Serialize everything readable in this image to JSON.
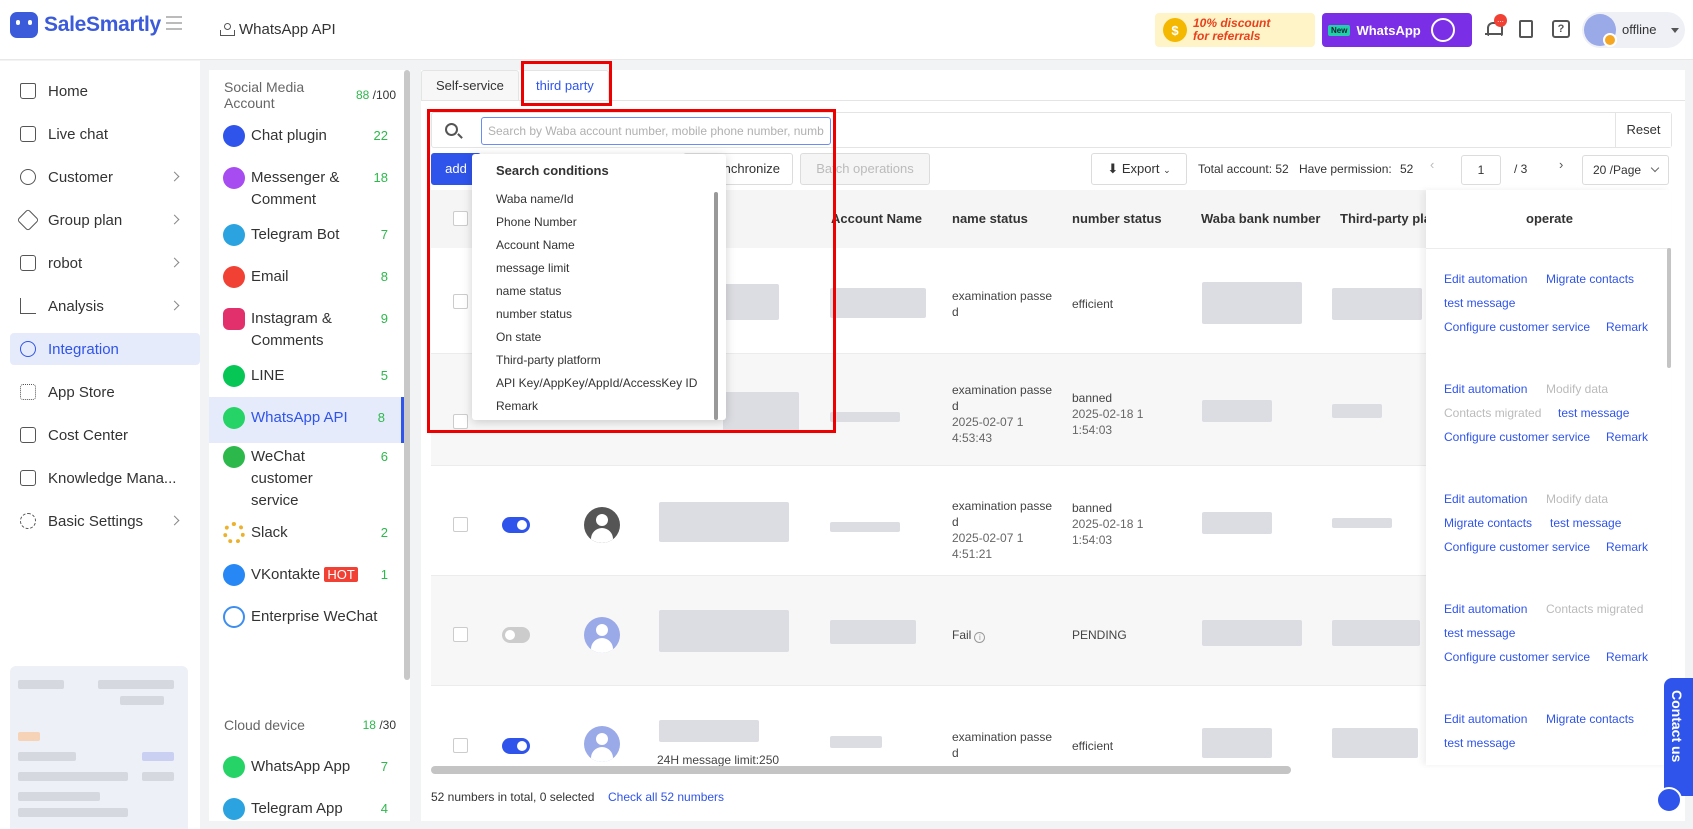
{
  "app": {
    "name": "SaleSmartly",
    "page": "WhatsApp API"
  },
  "promos": {
    "discount": "10% discount for referrals",
    "discount_line1": "10% discount",
    "discount_line2": "for referrals",
    "new_badge": "New",
    "whatsapp": "WhatsApp"
  },
  "header": {
    "notification_count": "...",
    "user_status": "offline"
  },
  "nav": [
    {
      "label": "Home",
      "icon": "home-icon"
    },
    {
      "label": "Live chat",
      "icon": "chat-icon"
    },
    {
      "label": "Customer",
      "icon": "customer-icon"
    },
    {
      "label": "Group plan",
      "icon": "send-icon"
    },
    {
      "label": "robot",
      "icon": "robot-icon"
    },
    {
      "label": "Analysis",
      "icon": "chart-icon"
    },
    {
      "label": "Integration",
      "icon": "integration-icon",
      "active": true
    },
    {
      "label": "App Store",
      "icon": "grid-icon"
    },
    {
      "label": "Cost Center",
      "icon": "wallet-icon"
    },
    {
      "label": "Knowledge Mana...",
      "icon": "book-icon"
    },
    {
      "label": "Basic Settings",
      "icon": "gear-icon"
    }
  ],
  "social": {
    "heading_line1": "Social Media",
    "heading_line2": "Account",
    "used": "88",
    "total": "/100",
    "channels": [
      {
        "label": "Chat plugin",
        "count": "22",
        "color": "#2f54eb"
      },
      {
        "label": "Messenger & Comment",
        "count": "18",
        "color": "#a64cf0"
      },
      {
        "label": "Telegram Bot",
        "count": "7",
        "color": "#2aa3e0"
      },
      {
        "label": "Email",
        "count": "8",
        "color": "#f04134"
      },
      {
        "label": "Instagram & Comments",
        "count": "9",
        "color": "#e1306c"
      },
      {
        "label": "LINE",
        "count": "5",
        "color": "#06c755"
      },
      {
        "label": "WhatsApp API",
        "count": "8",
        "color": "#25d366"
      },
      {
        "label": "WeChat customer service",
        "count": "6",
        "color": "#2db84c"
      },
      {
        "label": "Slack",
        "count": "2",
        "color": "#ecb22e"
      },
      {
        "label": "VKontakte",
        "hot": "HOT",
        "count": "1",
        "color": "#2787f5"
      },
      {
        "label": "Enterprise WeChat",
        "count": "",
        "color": "#3d8ef0"
      }
    ]
  },
  "cloud": {
    "heading": "Cloud device",
    "used": "18",
    "total": "/30",
    "channels": [
      {
        "label": "WhatsApp App",
        "count": "7",
        "color": "#25d366"
      },
      {
        "label": "Telegram App",
        "count": "4",
        "color": "#2aa3e0"
      }
    ]
  },
  "tabs": {
    "self_service": "Self-service",
    "third_party": "third party"
  },
  "search": {
    "placeholder": "Search by Waba account number, mobile phone number, numb",
    "reset": "Reset"
  },
  "toolbar": {
    "add": "add",
    "synchronize": "Synchronize",
    "batch": "Batch operations",
    "export": "Export",
    "total_accounts": "Total account: 52",
    "permission": "Have permission:",
    "permission_count": "52",
    "page_current": "1",
    "page_total": "/ 3",
    "page_size": "20 /Page"
  },
  "dropdown": {
    "title": "Search conditions",
    "items": [
      "Waba name/Id",
      "Phone Number",
      "Account Name",
      "message limit",
      "name status",
      "number status",
      "On state",
      "Third-party platform",
      "API Key/AppKey/AppId/AccessKey ID",
      "Remark"
    ]
  },
  "columns": {
    "account_name": "Account Name",
    "name_status": "name status",
    "number_status": "number status",
    "waba_bank": "Waba bank number",
    "third_party": "Third-party platf",
    "operate": "operate"
  },
  "rows": [
    {
      "name_status_1": "examination passe",
      "name_status_2": "d",
      "name_date": "",
      "number_status": "efficient",
      "number_date": "",
      "ops": [
        "Edit automation",
        "Migrate contacts",
        "test message",
        "Configure customer service",
        "Remark"
      ]
    },
    {
      "name_status_1": "examination passe",
      "name_status_2": "d",
      "name_date": "2025-02-07 1 4:53:43",
      "number_status": "banned",
      "number_date": "2025-02-18 1 1:54:03",
      "ops": [
        "Edit automation",
        "Modify data",
        "Contacts migrated",
        "test message",
        "Configure customer service",
        "Remark"
      ]
    },
    {
      "name_status_1": "examination passe",
      "name_status_2": "d",
      "name_date": "2025-02-07 1 4:51:21",
      "number_status": "banned",
      "number_date": "2025-02-18 1 1:54:03",
      "ops": [
        "Edit automation",
        "Modify data",
        "Migrate contacts",
        "test message",
        "Configure customer service",
        "Remark"
      ]
    },
    {
      "name_status_1": "Fail",
      "name_status_2": "",
      "name_date": "",
      "number_status": "PENDING",
      "number_date": "",
      "ops": [
        "Edit automation",
        "Contacts migrated",
        "test message",
        "Configure customer service",
        "Remark"
      ]
    },
    {
      "name_status_1": "examination passe",
      "name_status_2": "d",
      "name_date": "",
      "number_status": "efficient",
      "number_date": "",
      "message_limit": "24H message limit:250",
      "ops": [
        "Edit automation",
        "Migrate contacts",
        "test message"
      ]
    }
  ],
  "footer": {
    "summary": "52 numbers in total, 0 selected",
    "check_all": "Check all 52 numbers"
  },
  "contact_us": "Contact us"
}
